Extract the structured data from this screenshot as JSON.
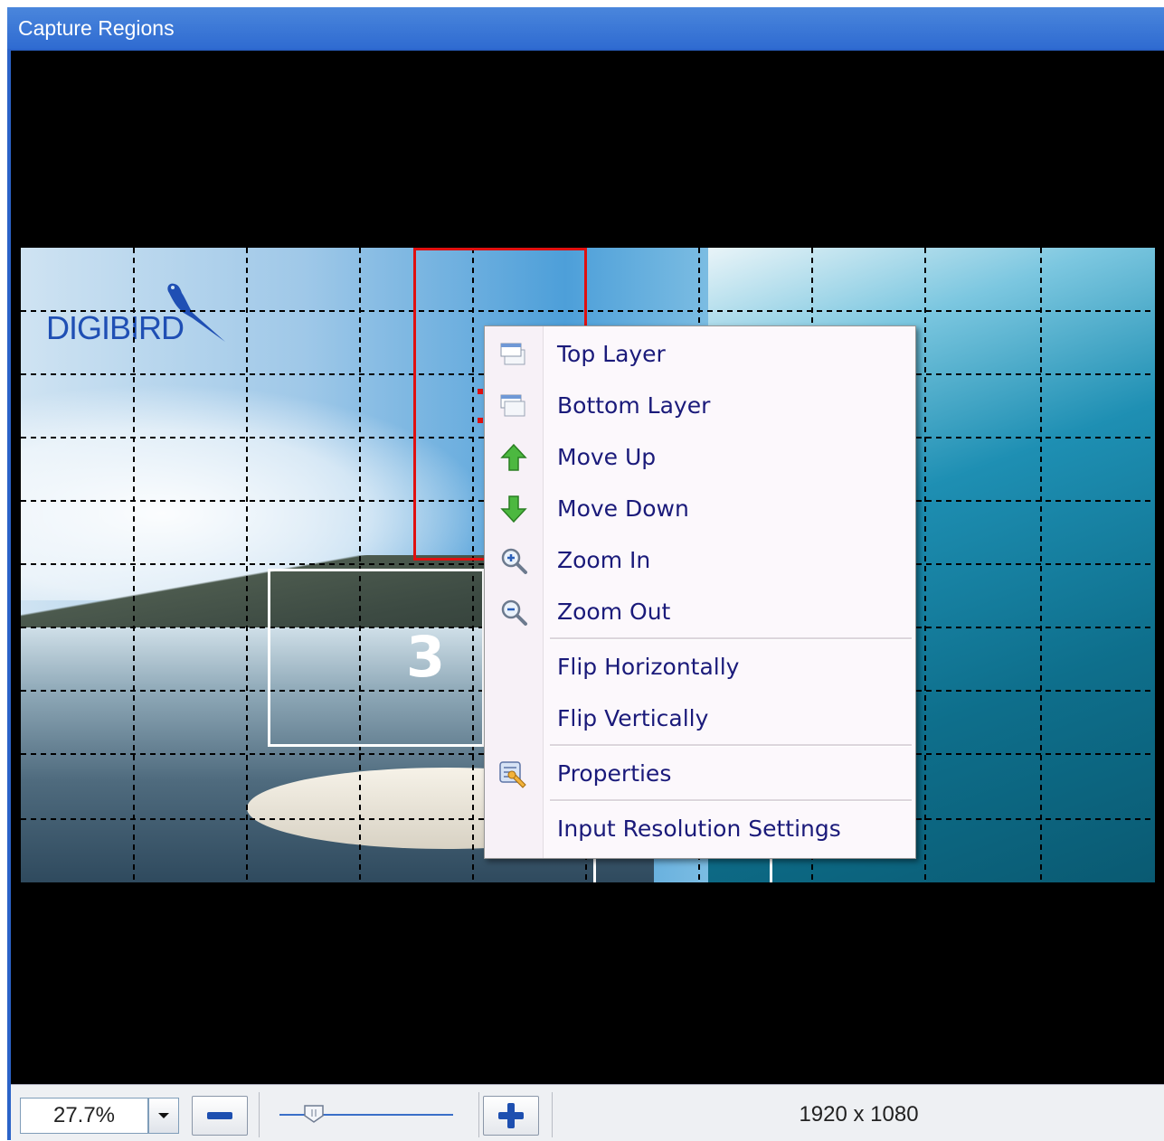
{
  "window": {
    "title": "Capture Regions"
  },
  "logo": {
    "text": "DIGIBIRD"
  },
  "regions": {
    "number_label": "3"
  },
  "context_menu": {
    "items": [
      {
        "label": "Top Layer",
        "icon": "top-layer-icon"
      },
      {
        "label": "Bottom Layer",
        "icon": "bottom-layer-icon"
      },
      {
        "label": "Move Up",
        "icon": "arrow-up-icon"
      },
      {
        "label": "Move Down",
        "icon": "arrow-down-icon"
      },
      {
        "label": "Zoom In",
        "icon": "zoom-in-icon"
      },
      {
        "label": "Zoom Out",
        "icon": "zoom-out-icon"
      },
      {
        "label": "Flip Horizontally",
        "icon": ""
      },
      {
        "label": "Flip Vertically",
        "icon": ""
      },
      {
        "label": "Properties",
        "icon": "properties-icon"
      },
      {
        "label": "Input Resolution Settings",
        "icon": ""
      }
    ]
  },
  "statusbar": {
    "zoom_value": "27.7%",
    "zoom_slider_level": 0.2,
    "resolution": "1920 x 1080"
  },
  "colors": {
    "titlebar": "#2f6bd1",
    "selected_region": "#e01010",
    "region_outline": "#ffffff",
    "menu_text": "#1a1a7a"
  }
}
